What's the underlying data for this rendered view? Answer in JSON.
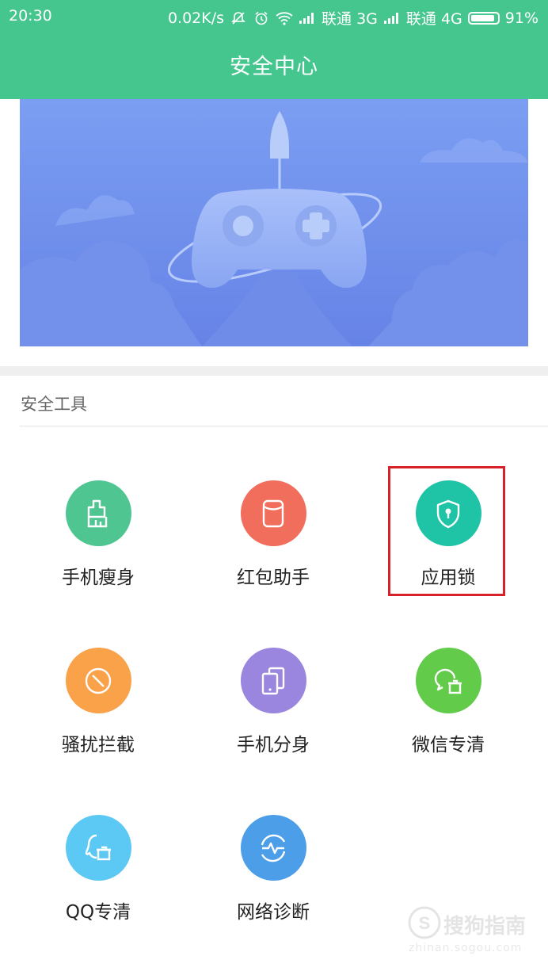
{
  "status": {
    "time": "20:30",
    "speed": "0.02K/s",
    "carrier1": "联通 3G",
    "carrier2": "联通 4G",
    "battery": "91%",
    "battery_level": 0.91
  },
  "header": {
    "title": "安全中心"
  },
  "section": {
    "title": "安全工具"
  },
  "tools": [
    {
      "label": "手机瘦身",
      "color": "#4fc692",
      "icon": "broom-icon"
    },
    {
      "label": "红包助手",
      "color": "#f16e5c",
      "icon": "red-envelope-icon"
    },
    {
      "label": "应用锁",
      "color": "#1fc3a6",
      "icon": "shield-lock-icon"
    },
    {
      "label": "骚扰拦截",
      "color": "#f9a24a",
      "icon": "block-icon"
    },
    {
      "label": "手机分身",
      "color": "#9b86df",
      "icon": "dual-phone-icon"
    },
    {
      "label": "微信专清",
      "color": "#62cb4a",
      "icon": "wechat-clean-icon"
    },
    {
      "label": "QQ专清",
      "color": "#5cc8f4",
      "icon": "qq-clean-icon"
    },
    {
      "label": "网络诊断",
      "color": "#4d9ee8",
      "icon": "network-diagnose-icon"
    }
  ],
  "watermark": {
    "text": "搜狗指南",
    "sub": "zhinan.sogou.com"
  }
}
